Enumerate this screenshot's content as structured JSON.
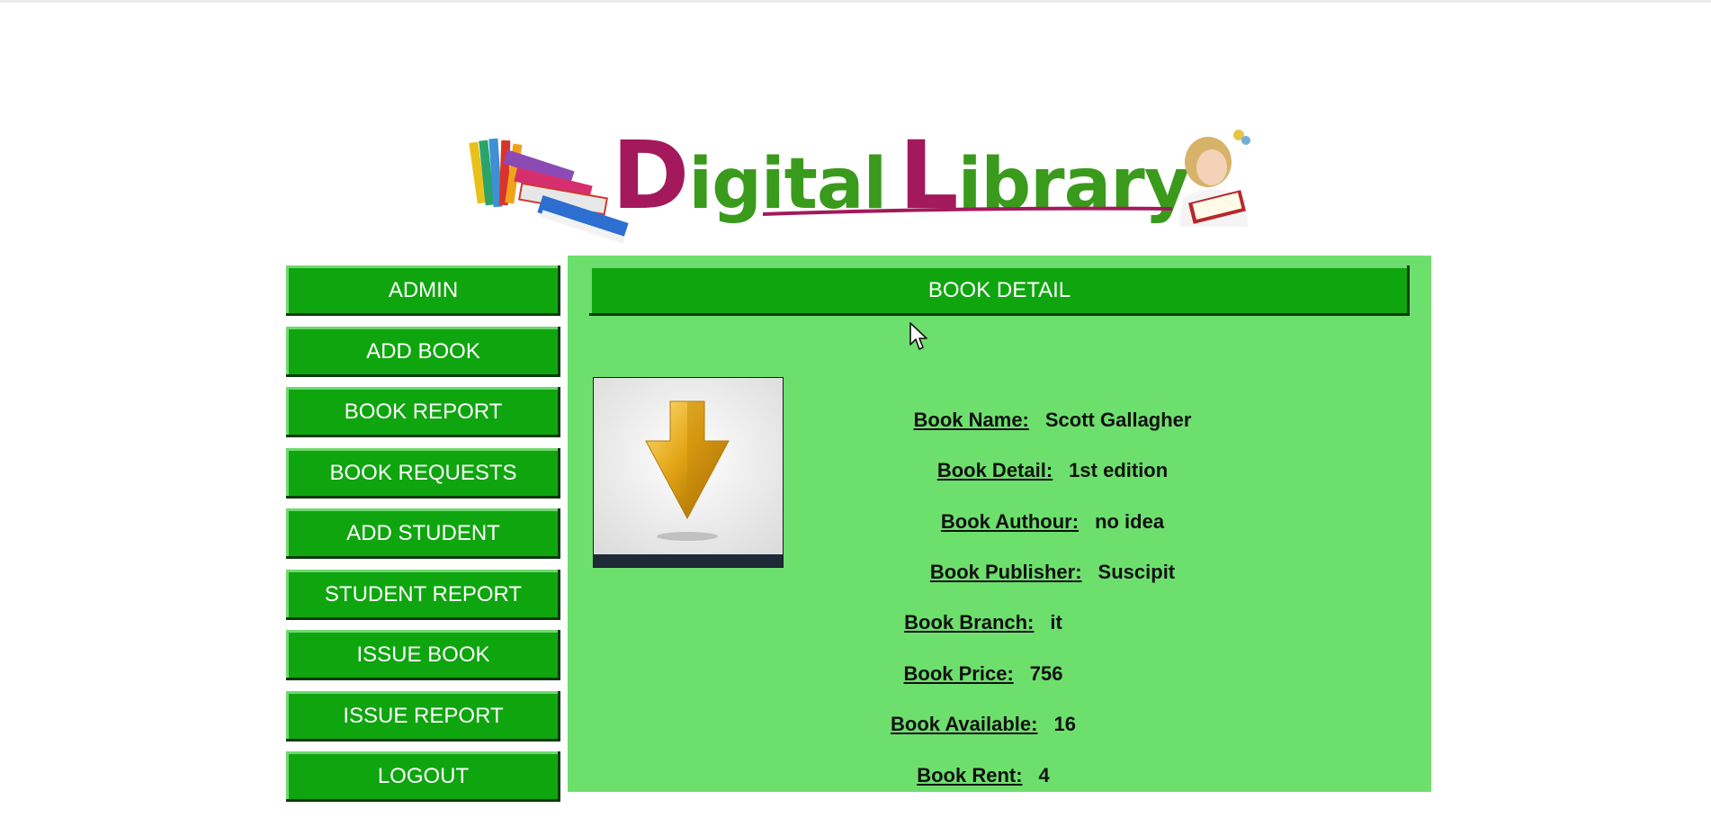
{
  "app": {
    "title_part1": "D",
    "title_part2": "igital",
    "title_part3": "L",
    "title_part4": "ibrary"
  },
  "colors": {
    "accent_green": "#0fa50f",
    "panel_green": "#6ddf6d",
    "logo_purple": "#a3195b",
    "logo_green": "#3a9a1c"
  },
  "sidebar": {
    "items": [
      {
        "label": "ADMIN"
      },
      {
        "label": "ADD BOOK"
      },
      {
        "label": "BOOK REPORT"
      },
      {
        "label": "BOOK REQUESTS"
      },
      {
        "label": "ADD STUDENT"
      },
      {
        "label": "STUDENT REPORT"
      },
      {
        "label": "ISSUE BOOK"
      },
      {
        "label": "ISSUE REPORT"
      },
      {
        "label": "LOGOUT"
      }
    ]
  },
  "main": {
    "title": "BOOK DETAIL",
    "cover_icon": "download-arrow-icon",
    "details": [
      {
        "label": "Book Name:",
        "value": "Scott Gallagher"
      },
      {
        "label": "Book Detail:",
        "value": "1st edition"
      },
      {
        "label": "Book Authour:",
        "value": "no idea"
      },
      {
        "label": "Book Publisher:",
        "value": "Suscipit"
      },
      {
        "label": "Book Branch:",
        "value": "it"
      },
      {
        "label": "Book Price:",
        "value": "756"
      },
      {
        "label": "Book Available:",
        "value": "16"
      },
      {
        "label": "Book Rent:",
        "value": "4"
      }
    ]
  }
}
